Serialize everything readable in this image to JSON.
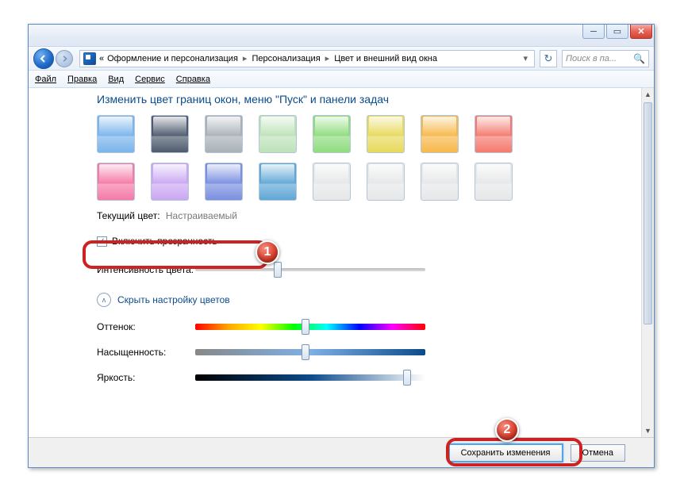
{
  "breadcrumb": {
    "prefix": "«",
    "seg1": "Оформление и персонализация",
    "seg2": "Персонализация",
    "seg3": "Цвет и внешний вид окна"
  },
  "search": {
    "placeholder": "Поиск в па..."
  },
  "menubar": {
    "file": "Файл",
    "edit": "Правка",
    "view": "Вид",
    "tools": "Сервис",
    "help": "Справка"
  },
  "heading": "Изменить цвет границ окон, меню \"Пуск\" и панели задач",
  "swatches_row1": [
    "#79b4eb",
    "#4e5a6d",
    "#a9b1b8",
    "#bde2b9",
    "#8fdc7e",
    "#e7d95a",
    "#f7b84a",
    "#f47a6e"
  ],
  "swatches_row2": [
    "#f57aa6",
    "#caa7f2",
    "#7a8fe0",
    "#5fa7d6",
    "#e6e7e8",
    "#e6e7e8",
    "#e6e7e8",
    "#e6e7e8"
  ],
  "current_color": {
    "label": "Текущий цвет:",
    "value": "Настраиваемый"
  },
  "transparency": {
    "label": "Включить прозрачность",
    "checked": true
  },
  "intensity": {
    "label": "Интенсивность цвета:",
    "pos": 36
  },
  "mixer_link": "Скрыть настройку цветов",
  "sliders": {
    "hue": {
      "label": "Оттенок:",
      "pos": 48
    },
    "sat": {
      "label": "Насыщенность:",
      "pos": 48
    },
    "bri": {
      "label": "Яркость:",
      "pos": 92
    }
  },
  "footer": {
    "save": "Сохранить изменения",
    "cancel": "Отмена"
  },
  "annotations": {
    "one": "1",
    "two": "2"
  }
}
